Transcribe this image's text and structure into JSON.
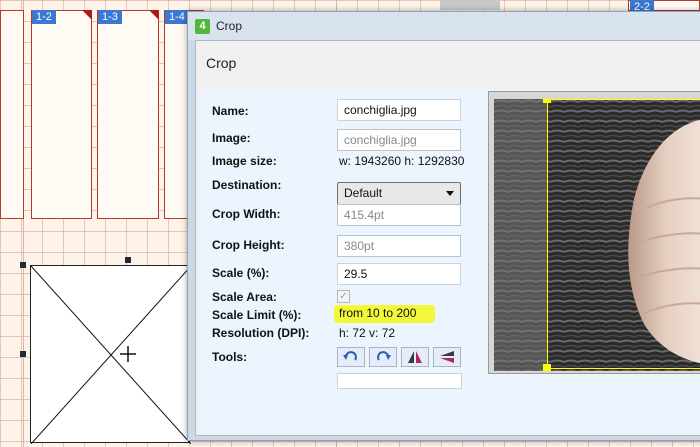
{
  "canvas": {
    "page_labels": [
      "1-2",
      "1-3",
      "1-4"
    ],
    "right_page_label": "2-2"
  },
  "dialog": {
    "title": "Crop",
    "heading": "Crop",
    "fields": {
      "name": {
        "label": "Name:",
        "value": "conchiglia.jpg"
      },
      "image": {
        "label": "Image:",
        "value": "conchiglia.jpg"
      },
      "image_size": {
        "label": "Image size:",
        "value": "w: 1943260 h: 1292830"
      },
      "destination": {
        "label": "Destination:",
        "value": "Default"
      },
      "crop_width": {
        "label": "Crop Width:",
        "value": "415.4pt"
      },
      "crop_height": {
        "label": "Crop Height:",
        "value": "380pt"
      },
      "scale": {
        "label": "Scale (%):",
        "value": "29.5"
      },
      "scale_area": {
        "label": "Scale Area:",
        "checked": true
      },
      "scale_limit": {
        "label": "Scale Limit (%):",
        "value": "from 10 to 200"
      },
      "resolution": {
        "label": "Resolution (DPI):",
        "value": "h: 72 v: 72"
      },
      "tools": {
        "label": "Tools:"
      }
    },
    "tools": [
      "rotate-left-icon",
      "rotate-right-icon",
      "flip-horizontal-icon",
      "flip-vertical-icon"
    ],
    "colors": {
      "highlight": "#f3f739",
      "crop_border": "#ffff00",
      "panel": "#ecf5fd"
    }
  }
}
